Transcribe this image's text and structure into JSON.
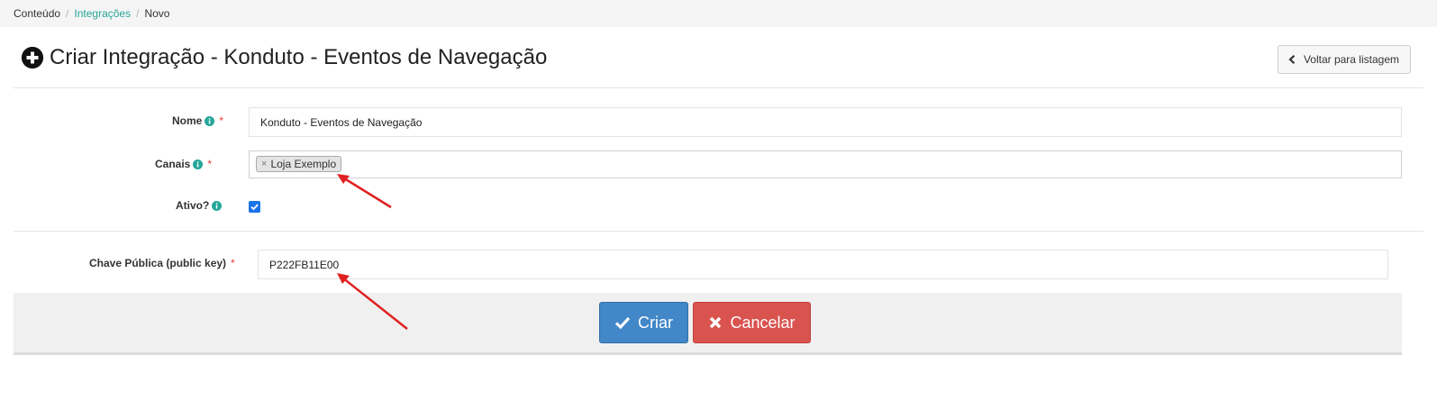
{
  "breadcrumb": {
    "items": [
      {
        "label": "Conteúdo"
      },
      {
        "label": "Integrações"
      },
      {
        "label": "Novo"
      }
    ],
    "separator": "/"
  },
  "header": {
    "title": "Criar Integração - Konduto - Eventos de Navegação",
    "title_icon": "plus-circle-icon",
    "back_button": {
      "label": "Voltar para listagem",
      "icon": "chevron-left-icon"
    }
  },
  "form": {
    "required_mark": "*",
    "nome": {
      "label": "Nome",
      "value": "Konduto - Eventos de Navegação"
    },
    "canais": {
      "label": "Canais",
      "tags": [
        "Loja Exemplo"
      ],
      "tag_remove": "×"
    },
    "ativo": {
      "label": "Ativo?",
      "checked": true
    },
    "chave_publica": {
      "label": "Chave Pública (public key)",
      "value": "P222FB11E00"
    }
  },
  "actions": {
    "criar": {
      "label": "Criar",
      "icon": "check-icon"
    },
    "cancelar": {
      "label": "Cancelar",
      "icon": "x-icon"
    }
  },
  "colors": {
    "link": "#26a69a",
    "info_icon": "#26a69a",
    "required": "#e53935",
    "primary_button": "#4287c8",
    "danger_button": "#d9534f",
    "checkbox": "#1a73e8",
    "annotation_arrow": "#e02020"
  }
}
